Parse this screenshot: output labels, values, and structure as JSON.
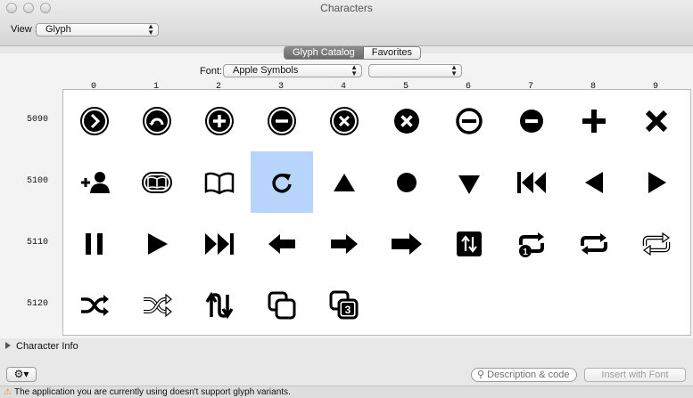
{
  "window": {
    "title": "Characters"
  },
  "toolbar": {
    "view_label": "View :",
    "view_value": "Glyph"
  },
  "tabs": [
    "Glyph Catalog",
    "Favorites"
  ],
  "font_bar": {
    "label": "Font:",
    "font_value": "Apple Symbols",
    "variant_value": ""
  },
  "columns": [
    "0",
    "1",
    "2",
    "3",
    "4",
    "5",
    "6",
    "7",
    "8",
    "9"
  ],
  "rows": [
    "5090",
    "5100",
    "5110",
    "5120"
  ],
  "glyphs": [
    [
      "right-circle-icon",
      "undo-circle-icon",
      "plus-circle-icon",
      "minus-circle-icon",
      "x-circle-icon",
      "x-filled-circle-icon",
      "minus-ring-icon",
      "minus-filled-circle-icon",
      "plus-icon",
      "x-icon"
    ],
    [
      "add-user-icon",
      "book-outline-icon",
      "open-book-icon",
      "reload-icon",
      "triangle-up-icon",
      "dot-icon",
      "triangle-down-icon",
      "rewind-icon",
      "triangle-left-icon",
      "triangle-right-icon"
    ],
    [
      "pause-icon",
      "play-icon",
      "fast-forward-icon",
      "arrow-left-icon",
      "arrow-right-icon",
      "arrow-right-wide-icon",
      "swap-vertical-icon",
      "repeat-one-icon",
      "repeat-icon",
      "repeat-outline-icon"
    ],
    [
      "shuffle-icon",
      "shuffle-outline-icon",
      "up-down-arrows-icon",
      "copy-icon",
      "copy-three-icon"
    ]
  ],
  "selected": {
    "row": 1,
    "col": 3
  },
  "copy3_label": "3",
  "repeat1_label": "1",
  "info": {
    "label": "Character Info"
  },
  "footer": {
    "gear_label": "⚙▾",
    "search_placeholder": "Description & code",
    "insert_label": "Insert with Font"
  },
  "status": {
    "message": "The application you are currently using doesn't support glyph variants."
  },
  "colors": {
    "selection": "#b7d5fb",
    "glyph": "#000000"
  }
}
